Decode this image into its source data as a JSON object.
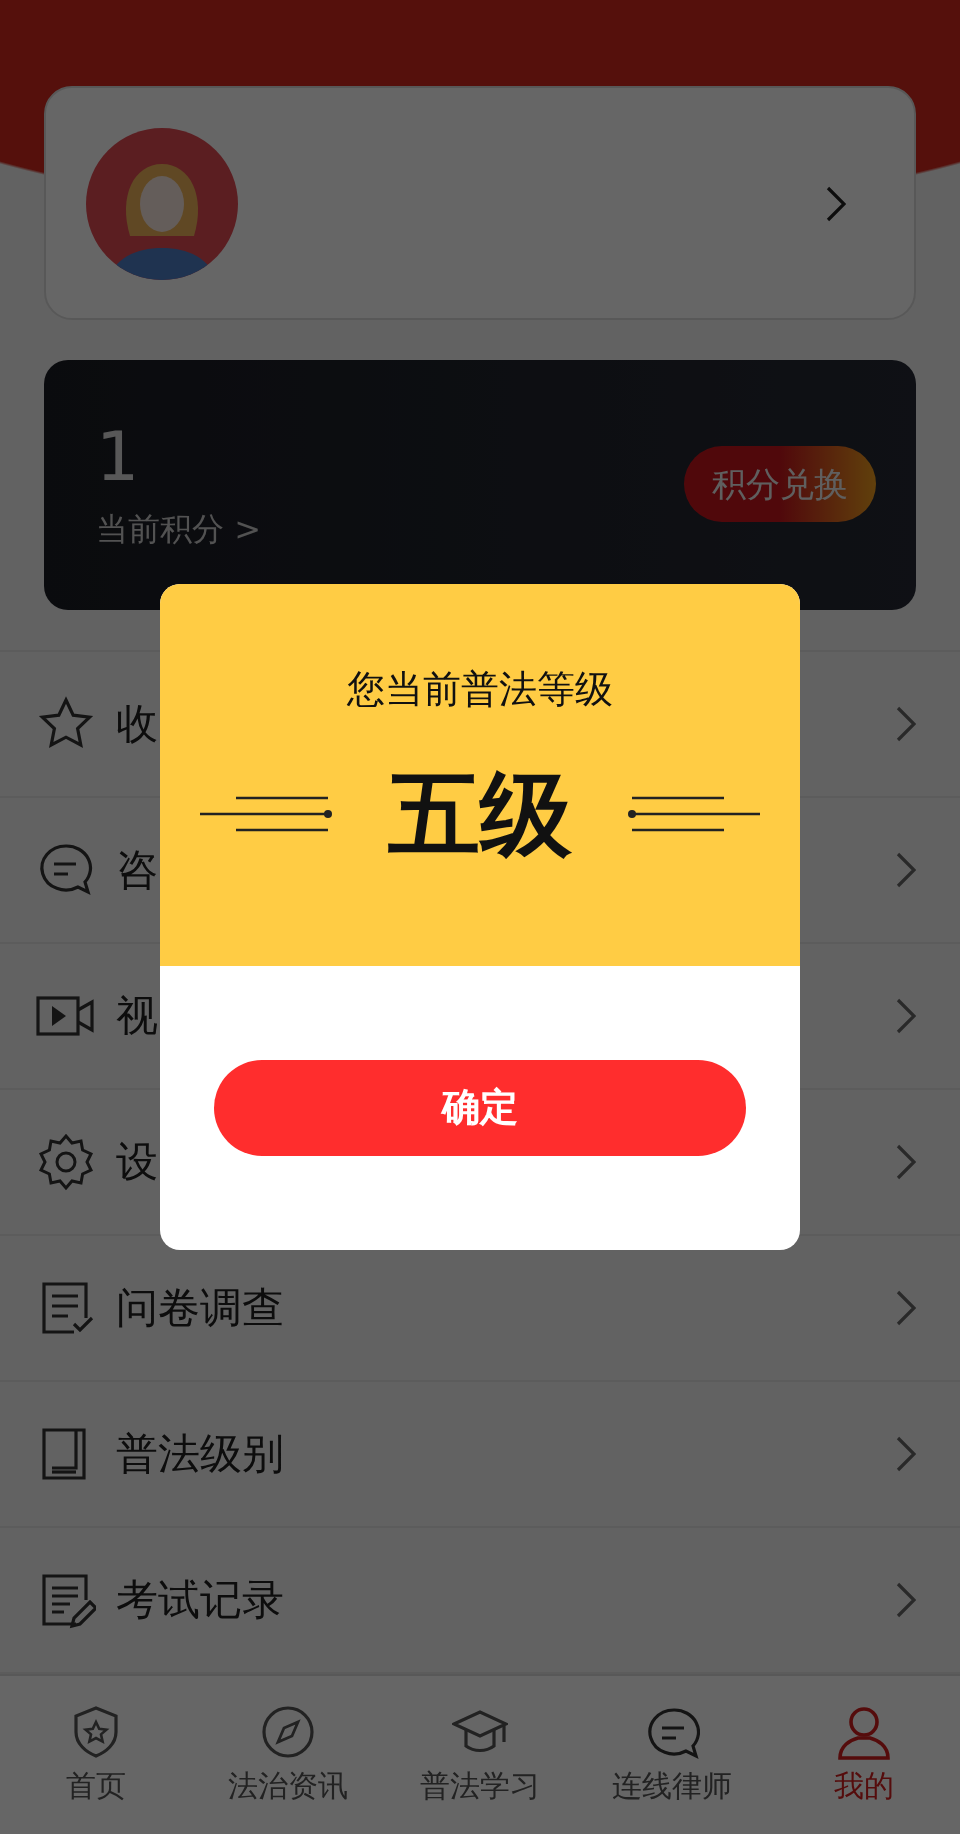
{
  "points": {
    "value": "1",
    "label": "当前积分 >",
    "exchange_button": "积分兑换"
  },
  "menu": [
    {
      "kind": "star",
      "label": "收"
    },
    {
      "kind": "chat",
      "label": "咨"
    },
    {
      "kind": "video",
      "label": "视"
    },
    {
      "kind": "gear",
      "label": "设"
    },
    {
      "kind": "survey",
      "label": "问卷调查"
    },
    {
      "kind": "book",
      "label": "普法级别"
    },
    {
      "kind": "exam",
      "label": "考试记录"
    }
  ],
  "tabs": [
    {
      "kind": "shield",
      "label": "首页",
      "selected": false
    },
    {
      "kind": "compass",
      "label": "法治资讯",
      "selected": false
    },
    {
      "kind": "cap",
      "label": "普法学习",
      "selected": false
    },
    {
      "kind": "chat",
      "label": "连线律师",
      "selected": false
    },
    {
      "kind": "person",
      "label": "我的",
      "selected": true
    }
  ],
  "dialog": {
    "title": "您当前普法等级",
    "grade": "五级",
    "confirm_button": "确定"
  }
}
